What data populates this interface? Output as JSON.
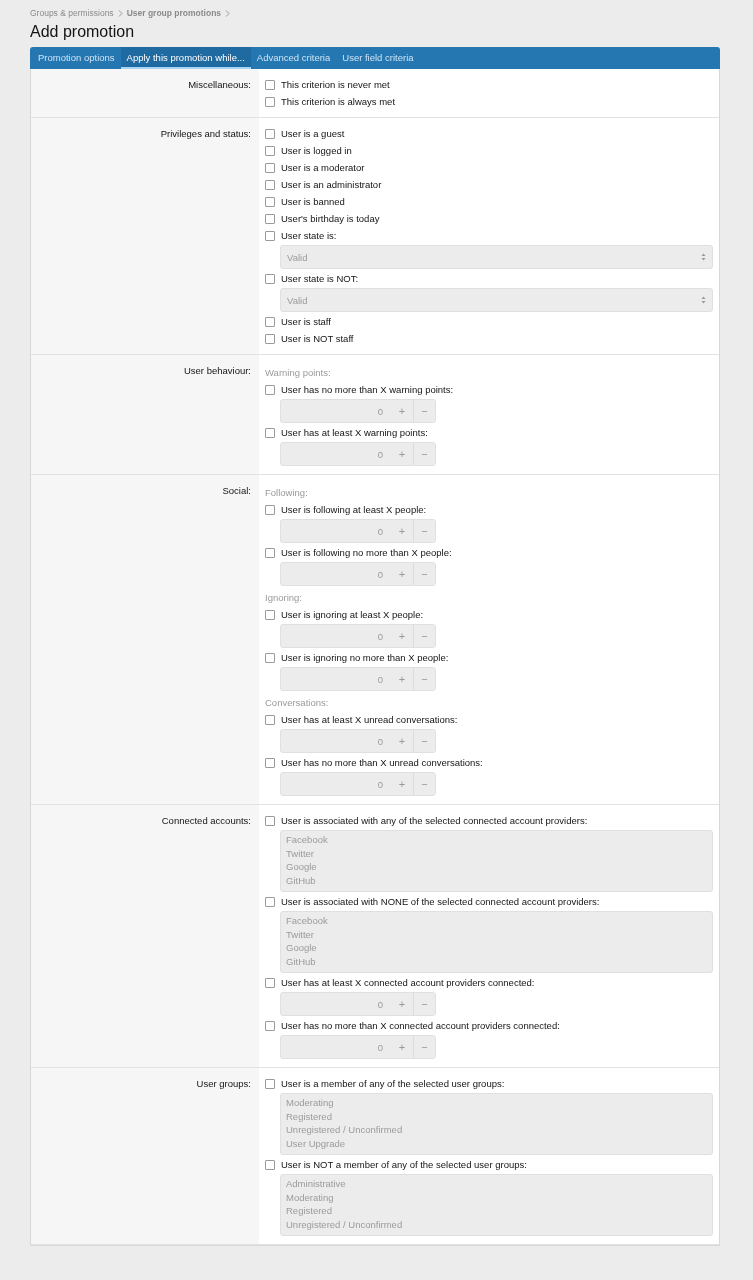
{
  "breadcrumb": [
    "Groups & permissions",
    "User group promotions"
  ],
  "title": "Add promotion",
  "tabs": [
    {
      "label": "Promotion options",
      "selected": false
    },
    {
      "label": "Apply this promotion while...",
      "selected": true
    },
    {
      "label": "Advanced criteria",
      "selected": false
    },
    {
      "label": "User field criteria",
      "selected": false
    }
  ],
  "sections": [
    {
      "label": "Miscellaneous:",
      "items": [
        {
          "kind": "checkbox",
          "label": "This criterion is never met",
          "checked": false
        },
        {
          "kind": "checkbox",
          "label": "This criterion is always met",
          "checked": false
        }
      ]
    },
    {
      "label": "Privileges and status:",
      "items": [
        {
          "kind": "checkbox",
          "label": "User is a guest",
          "checked": false
        },
        {
          "kind": "checkbox",
          "label": "User is logged in",
          "checked": false
        },
        {
          "kind": "checkbox",
          "label": "User is a moderator",
          "checked": false
        },
        {
          "kind": "checkbox",
          "label": "User is an administrator",
          "checked": false
        },
        {
          "kind": "checkbox",
          "label": "User is banned",
          "checked": false
        },
        {
          "kind": "checkbox",
          "label": "User's birthday is today",
          "checked": false
        },
        {
          "kind": "checkbox",
          "label": "User state is:",
          "checked": false,
          "control": {
            "kind": "select",
            "value": "Valid"
          }
        },
        {
          "kind": "checkbox",
          "label": "User state is NOT:",
          "checked": false,
          "control": {
            "kind": "select",
            "value": "Valid"
          }
        },
        {
          "kind": "checkbox",
          "label": "User is staff",
          "checked": false
        },
        {
          "kind": "checkbox",
          "label": "User is NOT staff",
          "checked": false
        }
      ]
    },
    {
      "label": "User behaviour:",
      "items": [
        {
          "kind": "heading",
          "label": "Warning points:"
        },
        {
          "kind": "checkbox",
          "label": "User has no more than X warning points:",
          "checked": false,
          "control": {
            "kind": "number",
            "value": "0",
            "plus": "+",
            "minus": "−"
          }
        },
        {
          "kind": "checkbox",
          "label": "User has at least X warning points:",
          "checked": false,
          "control": {
            "kind": "number",
            "value": "0",
            "plus": "+",
            "minus": "−"
          }
        }
      ]
    },
    {
      "label": "Social:",
      "items": [
        {
          "kind": "heading",
          "label": "Following:"
        },
        {
          "kind": "checkbox",
          "label": "User is following at least X people:",
          "checked": false,
          "control": {
            "kind": "number",
            "value": "0",
            "plus": "+",
            "minus": "−"
          }
        },
        {
          "kind": "checkbox",
          "label": "User is following no more than X people:",
          "checked": false,
          "control": {
            "kind": "number",
            "value": "0",
            "plus": "+",
            "minus": "−"
          }
        },
        {
          "kind": "heading",
          "label": "Ignoring:"
        },
        {
          "kind": "checkbox",
          "label": "User is ignoring at least X people:",
          "checked": false,
          "control": {
            "kind": "number",
            "value": "0",
            "plus": "+",
            "minus": "−"
          }
        },
        {
          "kind": "checkbox",
          "label": "User is ignoring no more than X people:",
          "checked": false,
          "control": {
            "kind": "number",
            "value": "0",
            "plus": "+",
            "minus": "−"
          }
        },
        {
          "kind": "heading",
          "label": "Conversations:"
        },
        {
          "kind": "checkbox",
          "label": "User has at least X unread conversations:",
          "checked": false,
          "control": {
            "kind": "number",
            "value": "0",
            "plus": "+",
            "minus": "−"
          }
        },
        {
          "kind": "checkbox",
          "label": "User has no more than X unread conversations:",
          "checked": false,
          "control": {
            "kind": "number",
            "value": "0",
            "plus": "+",
            "minus": "−"
          }
        }
      ]
    },
    {
      "label": "Connected accounts:",
      "items": [
        {
          "kind": "checkbox",
          "label": "User is associated with any of the selected connected account providers:",
          "checked": false,
          "control": {
            "kind": "list",
            "options": [
              "Facebook",
              "Twitter",
              "Google",
              "GitHub"
            ]
          }
        },
        {
          "kind": "checkbox",
          "label": "User is associated with NONE of the selected connected account providers:",
          "checked": false,
          "control": {
            "kind": "list",
            "options": [
              "Facebook",
              "Twitter",
              "Google",
              "GitHub"
            ]
          }
        },
        {
          "kind": "checkbox",
          "label": "User has at least X connected account providers connected:",
          "checked": false,
          "control": {
            "kind": "number",
            "value": "0",
            "plus": "+",
            "minus": "−"
          }
        },
        {
          "kind": "checkbox",
          "label": "User has no more than X connected account providers connected:",
          "checked": false,
          "control": {
            "kind": "number",
            "value": "0",
            "plus": "+",
            "minus": "−"
          }
        }
      ]
    },
    {
      "label": "User groups:",
      "items": [
        {
          "kind": "checkbox",
          "label": "User is a member of any of the selected user groups:",
          "checked": false,
          "control": {
            "kind": "list",
            "options": [
              "Moderating",
              "Registered",
              "Unregistered / Unconfirmed",
              "User Upgrade"
            ]
          }
        },
        {
          "kind": "checkbox",
          "label": "User is NOT a member of any of the selected user groups:",
          "checked": false,
          "control": {
            "kind": "list",
            "options": [
              "Administrative",
              "Moderating",
              "Registered",
              "Unregistered / Unconfirmed"
            ]
          }
        }
      ]
    }
  ]
}
